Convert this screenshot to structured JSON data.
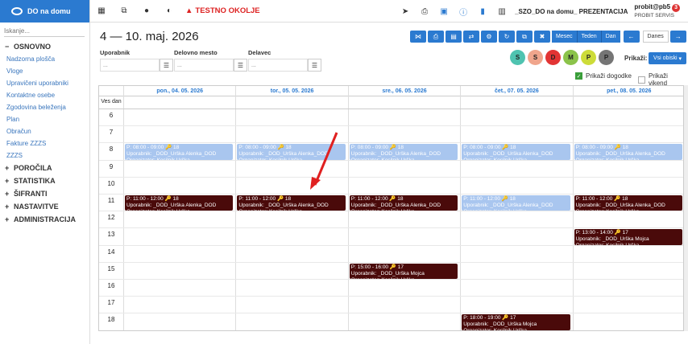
{
  "sidebar": {
    "logo_text": "DO na domu",
    "search_placeholder": "Iskanje...",
    "osnovno": {
      "label": "OSNOVNO",
      "items": [
        "Nadzorna plošča",
        "Vloge",
        "Upravičeni uporabniki",
        "Kontaktne osebe",
        "Zgodovina beleženja",
        "Plan",
        "Obračun",
        "Fakture ZZZS",
        "ZZZS"
      ]
    },
    "sections": [
      "POROČILA",
      "STATISTIKA",
      "ŠIFRANTI",
      "NASTAVITVE",
      "ADMINISTRACIJA"
    ]
  },
  "topbar": {
    "warning_text": "TESTNO OKOLJE",
    "project_name": "_SZO_DO na domu_ PREZENTACIJA",
    "user_name": "probit@pb5",
    "user_sub": "PROBIT SERVIS",
    "badge_count": "3"
  },
  "page": {
    "title": "4 — 10. maj. 2026"
  },
  "toolbar": {
    "views": [
      "Mesec",
      "Teden",
      "Dan"
    ],
    "today_label": "Danes"
  },
  "filters": {
    "uporabnik": {
      "label": "Uporabnik",
      "placeholder": "..."
    },
    "delovno_mesto": {
      "label": "Delovno mesto",
      "placeholder": "..."
    },
    "delavec": {
      "label": "Delavec",
      "placeholder": "..."
    }
  },
  "circles": [
    {
      "letter": "S",
      "color": "#4fc3b0"
    },
    {
      "letter": "S",
      "color": "#f0a58c"
    },
    {
      "letter": "D",
      "color": "#e23434"
    },
    {
      "letter": "M",
      "color": "#8bc34a"
    },
    {
      "letter": "P",
      "color": "#cddc39"
    },
    {
      "letter": "P",
      "color": "#757575"
    }
  ],
  "prikazi": {
    "label": "Prikaži:",
    "button": "Vsi obiski"
  },
  "checkboxes": {
    "dogodke": "Prikaži dogodke",
    "vikend": "Prikaži vikend"
  },
  "calendar": {
    "days": [
      "pon., 04. 05. 2026",
      "tor., 05. 05. 2026",
      "sre., 06. 05. 2026",
      "čet., 07. 05. 2026",
      "pet., 08. 05. 2026"
    ],
    "all_day_label": "Ves dan",
    "hours": [
      "6",
      "7",
      "8",
      "9",
      "10",
      "11",
      "12",
      "13",
      "14",
      "15",
      "16",
      "17",
      "18"
    ],
    "events": [
      {
        "day": 0,
        "start": 8,
        "end": 9,
        "style": "light",
        "time": "P: 08:00 - 09:00",
        "count": "18",
        "user": "Uporabnik: _DOD_Urška Alenka_DOD",
        "org": "Organizator: Kosilnik Urška"
      },
      {
        "day": 1,
        "start": 8,
        "end": 9,
        "style": "light",
        "time": "P: 08:00 - 09:00",
        "count": "18",
        "user": "Uporabnik: _DOD_Urška Alenka_DOD",
        "org": "Organizator: Kosilnik Urška"
      },
      {
        "day": 2,
        "start": 8,
        "end": 9,
        "style": "light",
        "time": "P: 08:00 - 09:00",
        "count": "18",
        "user": "Uporabnik: _DOD_Urška Alenka_DOD",
        "org": "Organizator: Kosilnik Urška"
      },
      {
        "day": 3,
        "start": 8,
        "end": 9,
        "style": "light",
        "time": "P: 08:00 - 09:00",
        "count": "18",
        "user": "Uporabnik: _DOD_Urška Alenka_DOD",
        "org": "Organizator: Kosilnik Urška"
      },
      {
        "day": 4,
        "start": 8,
        "end": 9,
        "style": "light",
        "time": "P: 08:00 - 09:00",
        "count": "18",
        "user": "Uporabnik: _DOD_Urška Alenka_DOD",
        "org": "Organizator: Kosilnik Urška"
      },
      {
        "day": 0,
        "start": 11,
        "end": 12,
        "style": "dark",
        "time": "P: 11:00 - 12:00",
        "count": "18",
        "user": "Uporabnik: _DOD_Urška Alenka_DOD",
        "org": "Organizator: Kosilnik Urška"
      },
      {
        "day": 1,
        "start": 11,
        "end": 12,
        "style": "dark",
        "time": "P: 11:00 - 12:00",
        "count": "18",
        "user": "Uporabnik: _DOD_Urška Alenka_DOD",
        "org": "Organizator: Kosilnik Urška"
      },
      {
        "day": 2,
        "start": 11,
        "end": 12,
        "style": "dark",
        "time": "P: 11:00 - 12:00",
        "count": "18",
        "user": "Uporabnik: _DOD_Urška Alenka_DOD",
        "org": "Organizator: Kosilnik Urška"
      },
      {
        "day": 3,
        "start": 11,
        "end": 12,
        "style": "light",
        "time": "P: 11:00 - 12:00",
        "count": "18",
        "user": "Uporabnik: _DOD_Urška Alenka_DOD",
        "org": "Organizator: Kosilnik Urška"
      },
      {
        "day": 4,
        "start": 11,
        "end": 12,
        "style": "dark",
        "time": "P: 11:00 - 12:00",
        "count": "18",
        "user": "Uporabnik: _DOD_Urška Alenka_DOD",
        "org": "Organizator: Kosilnik Urška"
      },
      {
        "day": 4,
        "start": 13,
        "end": 14,
        "style": "dark",
        "time": "P: 13:00 - 14:00",
        "count": "17",
        "user": "Uporabnik: _DOD_Urška Mojca",
        "org": "Organizator: Kosilnik Urška"
      },
      {
        "day": 2,
        "start": 15,
        "end": 16,
        "style": "dark",
        "time": "P: 15:00 - 16:00",
        "count": "17",
        "user": "Uporabnik: _DOD_Urška Mojca",
        "org": "Organizator: Kosilnik Urška"
      },
      {
        "day": 3,
        "start": 18,
        "end": 19,
        "style": "dark",
        "time": "P: 18:00 - 19:00",
        "count": "17",
        "user": "Uporabnik: _DOD_Urška Mojca",
        "org": "Organizator: Kosilnik Urška"
      }
    ]
  }
}
